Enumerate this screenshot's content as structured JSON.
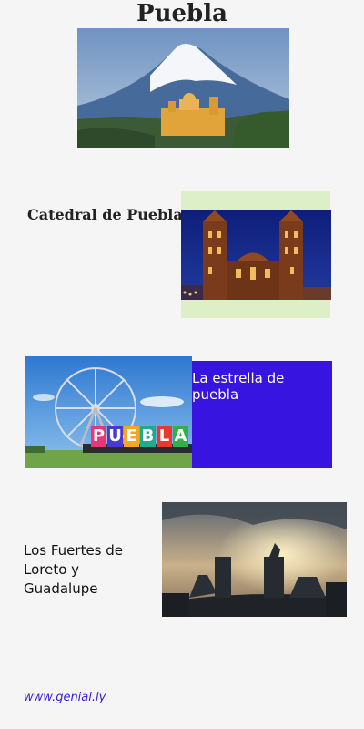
{
  "page": {
    "title": "Puebla"
  },
  "sections": {
    "cathedral": {
      "label": "Catedral de Puebla"
    },
    "star": {
      "label": "La estrella de puebla"
    },
    "forts": {
      "label": "Los Fuertes de Loreto y Guadalupe"
    }
  },
  "footer": {
    "link": "www.genial.ly"
  },
  "sign": {
    "letters": [
      "P",
      "U",
      "E",
      "B",
      "L",
      "A"
    ]
  },
  "colors": {
    "background": "#f5f5f5",
    "accent_blue": "#3714df",
    "accent_green": "#dcefc6",
    "footer_link": "#3a19d8"
  }
}
